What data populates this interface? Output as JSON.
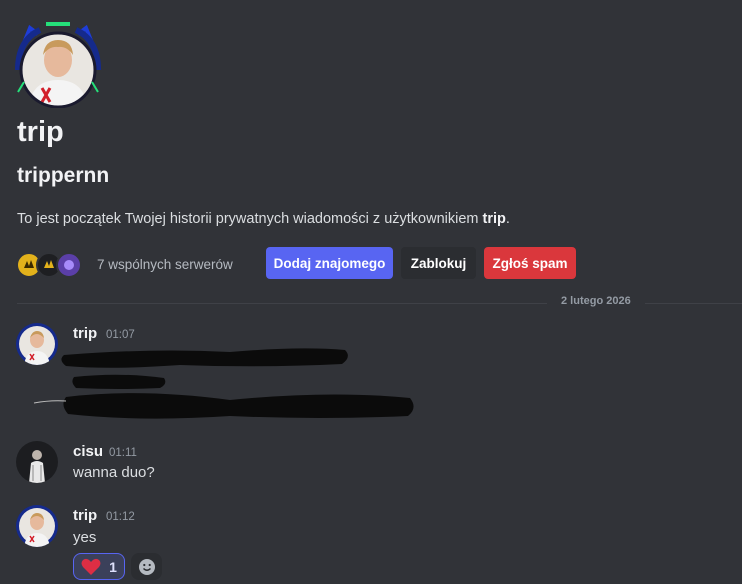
{
  "profile": {
    "display_name": "trip",
    "username": "trippernn",
    "intro_prefix": "To jest początek Twojej historii prywatnych wiadomości z użytkownikiem ",
    "intro_name": "trip",
    "intro_suffix": "."
  },
  "mutual": {
    "label": "7 wspólnych serwerów",
    "guild_icons": [
      "guild-icon-1",
      "guild-icon-2",
      "guild-icon-3"
    ]
  },
  "actions": {
    "add_friend": "Dodaj znajomego",
    "block": "Zablokuj",
    "report_spam": "Zgłoś spam"
  },
  "divider": {
    "date": "2 lutego 2026"
  },
  "messages": [
    {
      "author": "trip",
      "time": "01:07",
      "text": ""
    },
    {
      "author": "cisu",
      "time": "01:11",
      "text": "wanna duo?"
    },
    {
      "author": "trip",
      "time": "01:12",
      "text": "yes"
    }
  ],
  "reaction": {
    "emoji": "heart-icon",
    "count": "1"
  },
  "colors": {
    "background": "#313338",
    "accent": "#5865f2",
    "danger": "#da373c"
  }
}
